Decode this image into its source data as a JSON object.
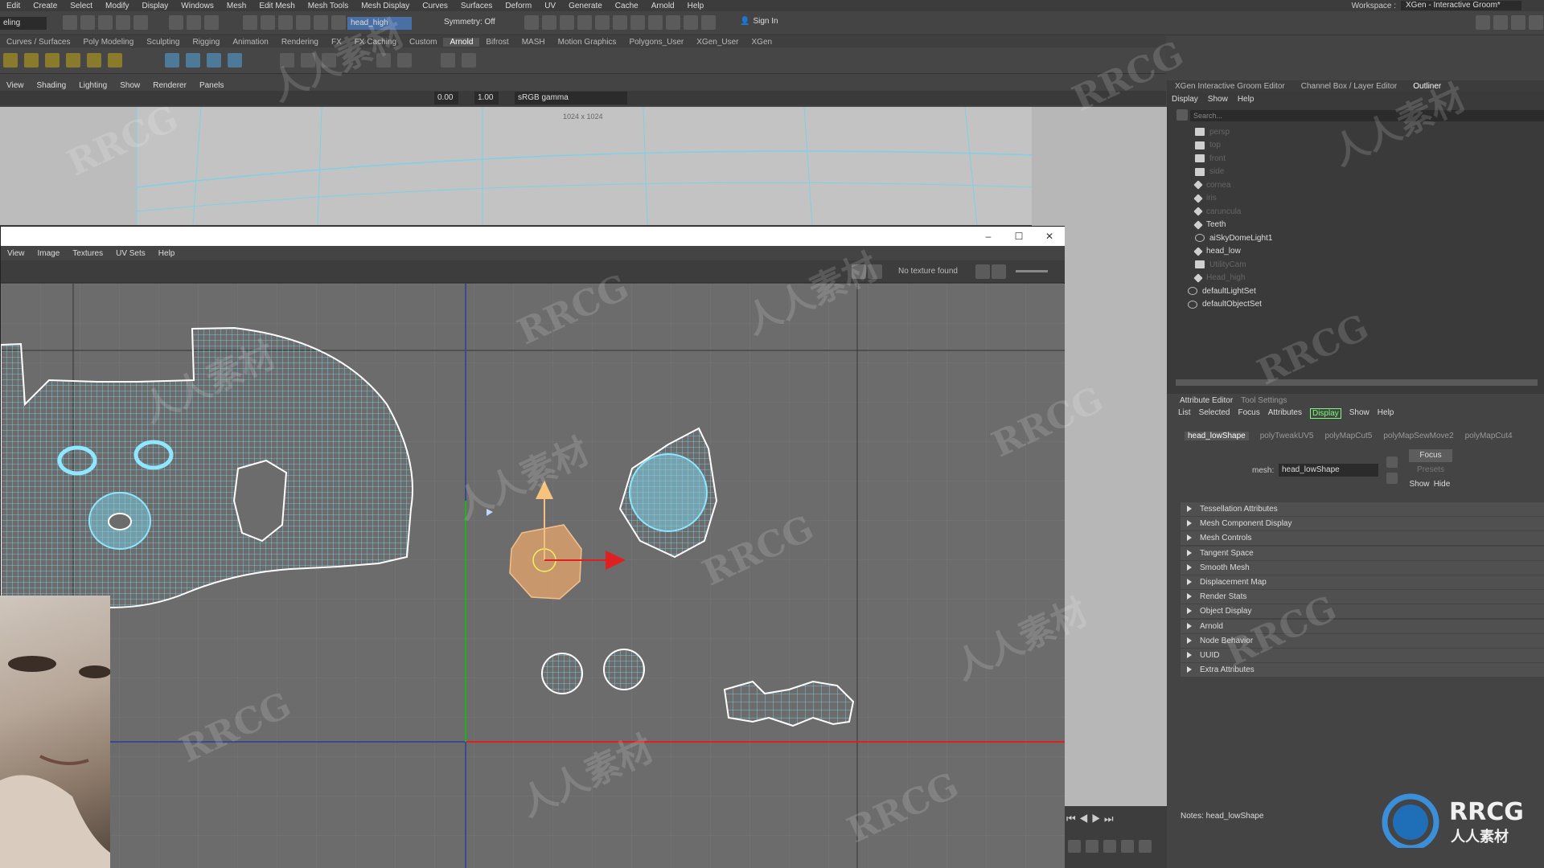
{
  "menubar": {
    "items": [
      "Edit",
      "Create",
      "Select",
      "Modify",
      "Display",
      "Windows",
      "Mesh",
      "Edit Mesh",
      "Mesh Tools",
      "Mesh Display",
      "Curves",
      "Surfaces",
      "Deform",
      "UV",
      "Generate",
      "Cache",
      "Arnold",
      "Help"
    ],
    "workspace_label": "Workspace :",
    "workspace_value": "XGen - Interactive Groom*"
  },
  "statusline": {
    "mode": "eling",
    "object_field": "head_high",
    "symmetry": "Symmetry: Off",
    "sign_in": "Sign In"
  },
  "shelf": {
    "tabs": [
      "Curves / Surfaces",
      "Poly Modeling",
      "Sculpting",
      "Rigging",
      "Animation",
      "Rendering",
      "FX",
      "FX Caching",
      "Custom",
      "Arnold",
      "Bifrost",
      "MASH",
      "Motion Graphics",
      "Polygons_User",
      "XGen_User",
      "XGen"
    ],
    "active_tab": "Arnold"
  },
  "viewport": {
    "menu": [
      "View",
      "Shading",
      "Lighting",
      "Show",
      "Renderer",
      "Panels"
    ],
    "field_a": "0.00",
    "field_b": "1.00",
    "color_space": "sRGB gamma",
    "resolution": "1024 x 1024"
  },
  "uv_editor": {
    "menu": [
      "View",
      "Image",
      "Textures",
      "UV Sets",
      "Help"
    ],
    "texture_status": "No texture found",
    "win_min": "–",
    "win_max": "☐",
    "win_close": "✕"
  },
  "right_panel": {
    "tabs": [
      "XGen Interactive Groom Editor",
      "Channel Box / Layer Editor",
      "Outliner"
    ],
    "active_tab": "Outliner",
    "outliner_menu": [
      "Display",
      "Show",
      "Help"
    ],
    "search_placeholder": "Search...",
    "outliner_items": [
      {
        "label": "persp",
        "dim": true,
        "icon": "camera-icon"
      },
      {
        "label": "top",
        "dim": true,
        "icon": "camera-icon"
      },
      {
        "label": "front",
        "dim": true,
        "icon": "camera-icon"
      },
      {
        "label": "side",
        "dim": true,
        "icon": "camera-icon"
      },
      {
        "label": "cornea",
        "dim": true,
        "icon": "mesh-icon"
      },
      {
        "label": "iris",
        "dim": true,
        "icon": "mesh-icon"
      },
      {
        "label": "caruncula",
        "dim": true,
        "icon": "mesh-icon"
      },
      {
        "label": "Teeth",
        "dim": false,
        "icon": "mesh-icon"
      },
      {
        "label": "aiSkyDomeLight1",
        "dim": false,
        "icon": "light-icon"
      },
      {
        "label": "head_low",
        "dim": false,
        "icon": "mesh-icon"
      },
      {
        "label": "UtilityCam",
        "dim": true,
        "icon": "camera-icon"
      },
      {
        "label": "Head_high",
        "dim": true,
        "icon": "mesh-icon"
      },
      {
        "label": "defaultLightSet",
        "dim": false,
        "icon": "set-icon"
      },
      {
        "label": "defaultObjectSet",
        "dim": false,
        "icon": "set-icon"
      }
    ]
  },
  "attribute_editor": {
    "tabs": [
      "Attribute Editor",
      "Tool Settings"
    ],
    "menu": [
      "List",
      "Selected",
      "Focus",
      "Attributes",
      "Display",
      "Show",
      "Help"
    ],
    "highlighted_menu": "Display",
    "nodes": [
      "head_lowShape",
      "polyTweakUV5",
      "polyMapCut5",
      "polyMapSewMove2",
      "polyMapCut4"
    ],
    "mesh_label": "mesh:",
    "mesh_value": "head_lowShape",
    "focus_btn": "Focus",
    "presets_btn": "Presets",
    "show_btn": "Show",
    "hide_btn": "Hide",
    "sections": [
      "Tessellation Attributes",
      "Mesh Component Display",
      "Mesh Controls",
      "Tangent Space",
      "Smooth Mesh",
      "Displacement Map",
      "Render Stats",
      "Object Display",
      "Arnold",
      "Node Behavior",
      "UUID",
      "Extra Attributes"
    ],
    "notes": "Notes: head_lowShape"
  },
  "watermark": {
    "text_a": "RRCG",
    "text_b": "人人素材",
    "logo_title": "RRCG",
    "logo_sub": "人人素材"
  },
  "colors": {
    "uv_wire": "#7fd6ee",
    "uv_shell_border": "#ffffff",
    "selected_shell": "#e7a56b",
    "axis_x": "#e02020",
    "axis_y": "#20b020",
    "highlight_green": "#78ff78"
  }
}
